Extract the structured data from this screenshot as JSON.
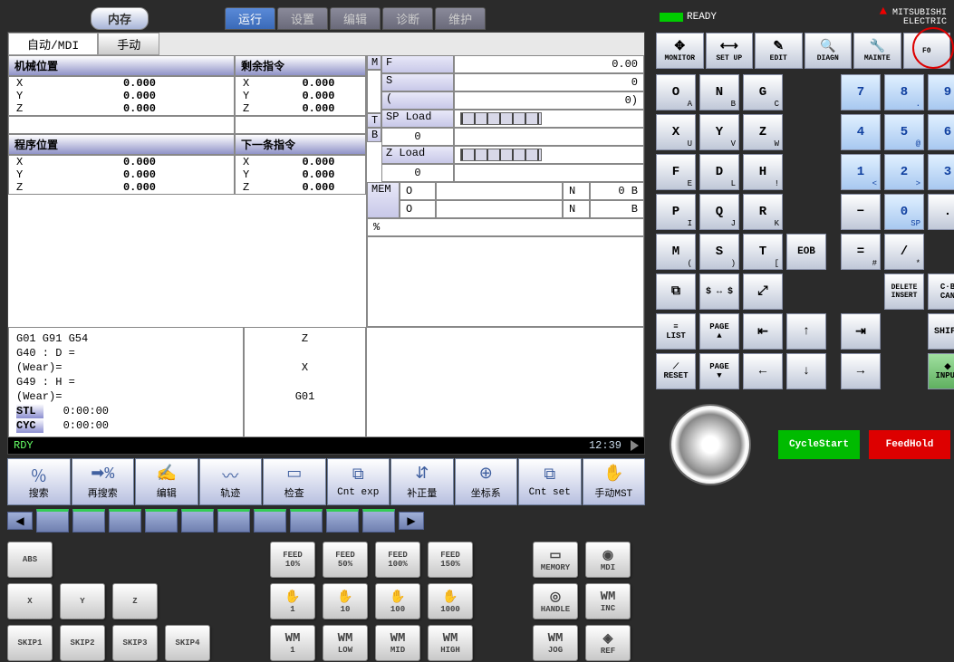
{
  "brand": {
    "name": "MITSUBISHI",
    "name2": "ELECTRIC",
    "ready": "READY"
  },
  "topTabs": {
    "mem": "内存",
    "run": "运行",
    "set": "设置",
    "edit": "编辑",
    "diag": "诊断",
    "maint": "维护"
  },
  "subTabs": {
    "auto": "自动/MDI",
    "manual": "手动"
  },
  "headers": {
    "machPos": "机械位置",
    "remCmd": "剩余指令",
    "progPos": "程序位置",
    "nextCmd": "下一条指令",
    "spLoad": "SP Load",
    "zLoad": "Z Load",
    "mem": "MEM"
  },
  "axes": {
    "x": "X",
    "y": "Y",
    "z": "Z"
  },
  "machPos": {
    "x": "0.000",
    "y": "0.000",
    "z": "0.000"
  },
  "remCmd": {
    "x": "0.000",
    "y": "0.000",
    "z": "0.000"
  },
  "progPos": {
    "x": "0.000",
    "y": "0.000",
    "z": "0.000"
  },
  "nextCmd": {
    "x": "0.000",
    "y": "0.000",
    "z": "0.000"
  },
  "rightTop": {
    "m": "M",
    "t": "T",
    "b": "B",
    "f": "F",
    "s": "S",
    "fVal": "0.00",
    "sVal": "0",
    "paren": "(",
    "parenVal": "0)",
    "spLoadVal": "0",
    "zLoadVal": "0"
  },
  "memRow": {
    "o1": "O",
    "n1": "N",
    "b1": "0 B",
    "o2": "O",
    "n2": "N",
    "b2": "B",
    "pct": "%"
  },
  "gcode": {
    "l1": "G01  G91 G54",
    "l2": "G40  :  D   =",
    "l3": "       (Wear)=",
    "l4": "G49  :  H   =",
    "l5": "       (Wear)=",
    "l6": "STL    0:00:00",
    "l7": "CYC    0:00:00",
    "rz": "Z",
    "rx": "X",
    "rg": "G01"
  },
  "status": {
    "rdy": "RDY",
    "time": "12:39"
  },
  "fn": {
    "search": "搜索",
    "research": "再搜索",
    "edit": "编辑",
    "trace": "轨迹",
    "check": "检查",
    "cntexp": "Cnt exp",
    "offset": "补正量",
    "coord": "坐标系",
    "cntset": "Cnt set",
    "manmst": "手动MST"
  },
  "modeBtns": {
    "monitor": "MONITOR",
    "setup": "SET UP",
    "edit": "EDIT",
    "diagn": "DIAGN",
    "mainte": "MAINTE",
    "f0": "F0"
  },
  "keys": {
    "O": "O",
    "N": "N",
    "G": "G",
    "X": "X",
    "Y": "Y",
    "Z": "Z",
    "F": "F",
    "H": "H",
    "D": "D",
    "P": "P",
    "Q": "Q",
    "R": "R",
    "M": "M",
    "S": "S",
    "T": "T",
    "oa": "A",
    "ob": "B",
    "oc": "C",
    "ou": "U",
    "ov": "V",
    "ow": "W",
    "oe": "E",
    "ol": "L",
    "oex": "!",
    "oi": "I",
    "oj": "J",
    "ok": "K",
    "op": "(",
    "oq": ")",
    "or": "[",
    "n7": "7",
    "n8": "8",
    "n9": "9",
    "n4": "4",
    "n5": "5",
    "n6": "6",
    "n1": "1",
    "n2": "2",
    "n3": "3",
    "n0": "0",
    "s9": "$",
    "s8": ".",
    "s5": "@",
    "s6": "~",
    "s1": "<",
    "s2": ">",
    "s3": "*",
    "sp": "SP",
    "minus": "−",
    "dot": ".",
    "eob": "EOB",
    "eq": "=",
    "eqh": "#",
    "slash": "/",
    "slh": "*",
    "comma": ",",
    "dollar": "$ ↔ $",
    "arr": "↕",
    "del": "DELETE",
    "ins": "INSERT",
    "cb": "C·B",
    "can": "CAN",
    "list": "LIST",
    "page": "PAGE",
    "up": "↑",
    "dn": "↓",
    "lt": "←",
    "rt": "→",
    "home": "⇤",
    "end": "⇥",
    "shift": "SHIFT",
    "reset": "RESET",
    "input": "INPUT"
  },
  "mbtn": {
    "abs": "ABS",
    "x": "X",
    "y": "Y",
    "z": "Z",
    "s1": "SKIP1",
    "s2": "SKIP2",
    "s3": "SKIP3",
    "s4": "SKIP4",
    "f10": "FEED",
    "f10v": "10%",
    "f50": "FEED",
    "f50v": "50%",
    "f100": "FEED",
    "f100v": "100%",
    "f150": "FEED",
    "f150v": "150%",
    "h1": "1",
    "h10": "10",
    "h100": "100",
    "h1000": "1000",
    "w1": "1",
    "wlow": "LOW",
    "wmid": "MID",
    "whigh": "HIGH",
    "memory": "MEMORY",
    "handle": "HANDLE",
    "jog": "JOG",
    "mdi": "MDI",
    "inc": "INC",
    "ref": "REF",
    "wm": "WM",
    "cycle": "CycleStart",
    "hold": "FeedHold"
  }
}
